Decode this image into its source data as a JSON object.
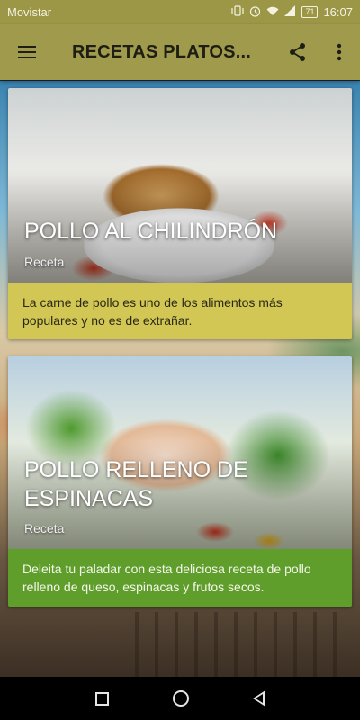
{
  "status_bar": {
    "carrier": "Movistar",
    "battery": "71",
    "time": "16:07",
    "icons": [
      "vibrate-icon",
      "alarm-icon",
      "wifi-icon",
      "signal-icon",
      "battery-icon"
    ]
  },
  "toolbar": {
    "title": "RECETAS PLATOS...",
    "menu_icon": "hamburger-menu-icon",
    "share_icon": "share-icon",
    "overflow_icon": "more-vert-icon",
    "color": "#a09a4c"
  },
  "recipes": [
    {
      "name": "POLLO AL CHILINDRÓN",
      "kind": "Receta",
      "description": "La carne de pollo es uno de los alimentos más populares y no es de extrañar.",
      "color": "#d2c655"
    },
    {
      "name": "POLLO RELLENO DE ESPINACAS",
      "kind": "Receta",
      "description": "Deleita tu paladar con esta deliciosa receta de pollo relleno de queso, espinacas y frutos secos.",
      "color": "#5f9e2a"
    }
  ],
  "nav_bar": {
    "recents_icon": "recents-square-icon",
    "home_icon": "home-circle-icon",
    "back_icon": "back-triangle-icon"
  }
}
